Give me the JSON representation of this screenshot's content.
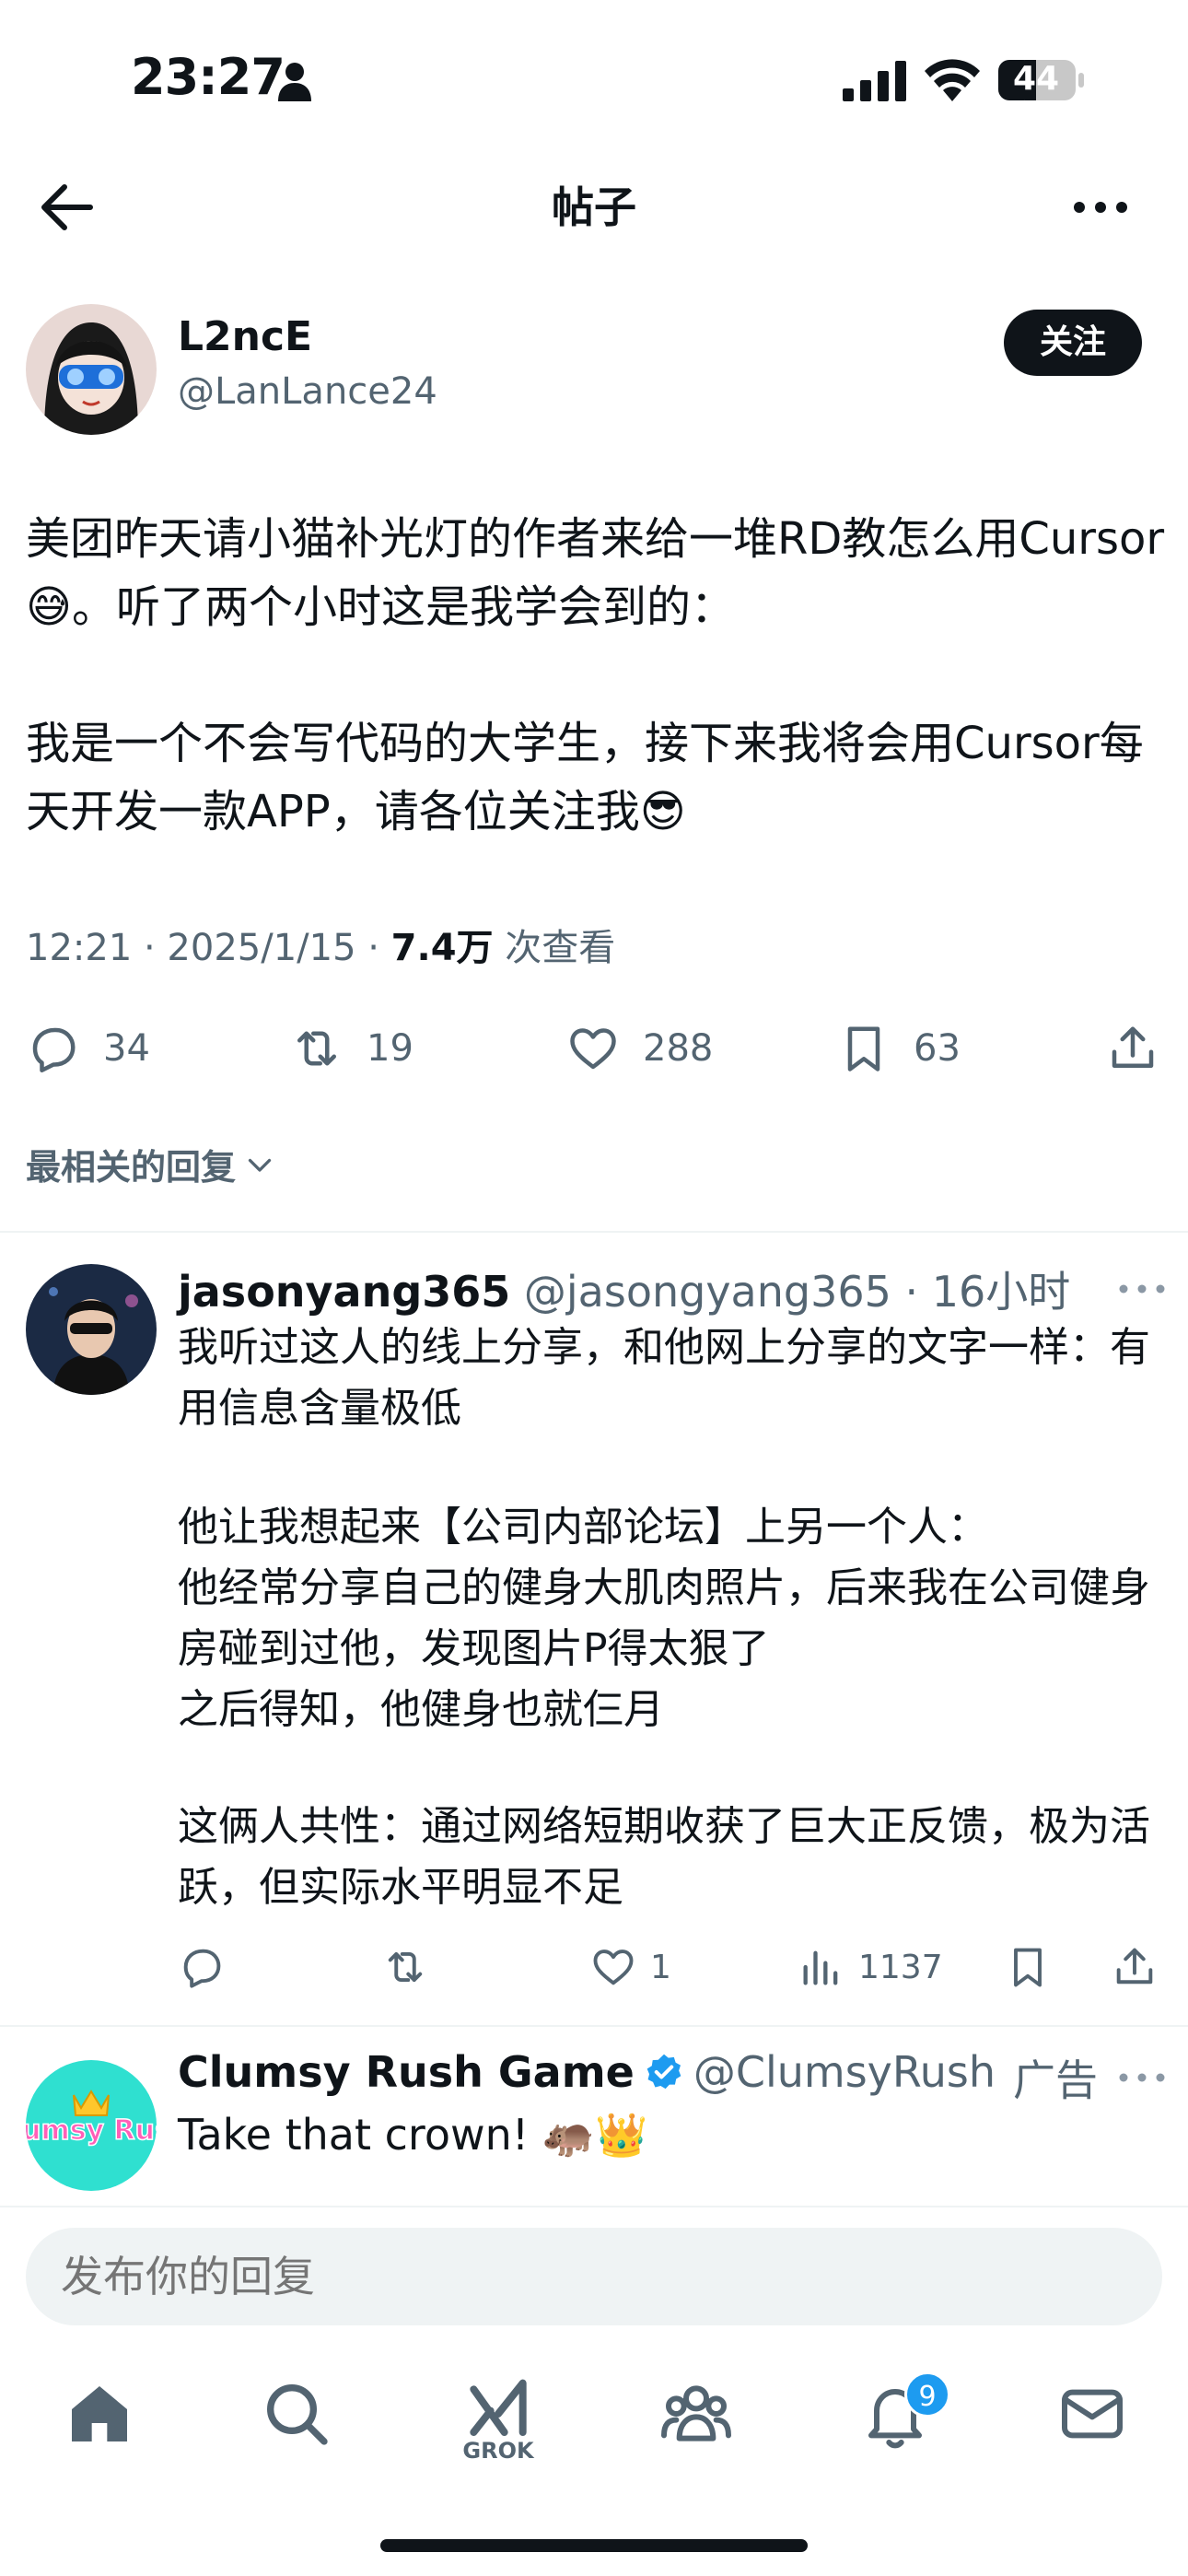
{
  "status_bar": {
    "time": "23:27",
    "battery": "44",
    "icons": [
      "person-icon",
      "signal-icon",
      "wifi-icon",
      "battery-icon"
    ]
  },
  "header": {
    "title": "帖子",
    "back_icon": "arrow-left-icon",
    "more_icon": "more-horizontal-icon"
  },
  "post": {
    "author": {
      "name": "L2ncE",
      "handle": "@LanLance24",
      "follow_label": "关注"
    },
    "paragraph_1": "美团昨天请小猫补光灯的作者来给一堆RD教怎么用Cursor😅。听了两个小时这是我学会到的：",
    "paragraph_2": "我是一个不会写代码的大学生，接下来我将会用Cursor每天开发一款APP，请各位关注我😎",
    "time_date": "12:21 · 2025/1/15 · ",
    "views": "7.4万",
    "views_label": " 次查看",
    "stats": {
      "replies": "34",
      "reposts": "19",
      "likes": "288",
      "bookmarks": "63"
    }
  },
  "sort": {
    "label": "最相关的回复"
  },
  "reply": {
    "name": "jasonyang365",
    "handle": " @jasongyang365",
    "time": " · 16小时",
    "paragraph_1": "我听过这人的线上分享，和他网上分享的文字一样：有用信息含量极低",
    "paragraph_2": "他让我想起来【公司内部论坛】上另一个人：\n他经常分享自己的健身大肌肉照片，后来我在公司健身房碰到过他，发现图片P得太狠了\n之后得知，他健身也就仨月",
    "paragraph_3": "这俩人共性：通过网络短期收获了巨大正反馈，极为活跃，但实际水平明显不足",
    "stats": {
      "likes": "1",
      "views": "1137"
    }
  },
  "ad": {
    "name": "Clumsy Rush Game",
    "handle": "@ClumsyRush",
    "label": "广告",
    "text": "Take that crown! 🦛👑",
    "avatar_text": "Clumsy Rush"
  },
  "composer": {
    "placeholder": "发布你的回复"
  },
  "tab_bar": {
    "grok_label": "GROK",
    "notification_count": "9",
    "tabs": [
      "home-icon",
      "search-icon",
      "grok-icon",
      "communities-icon",
      "notifications-icon",
      "messages-icon"
    ]
  },
  "colors": {
    "text": "#0f1419",
    "secondary": "#536471",
    "accent": "#1d9bf0",
    "divider": "#eff3f4"
  }
}
